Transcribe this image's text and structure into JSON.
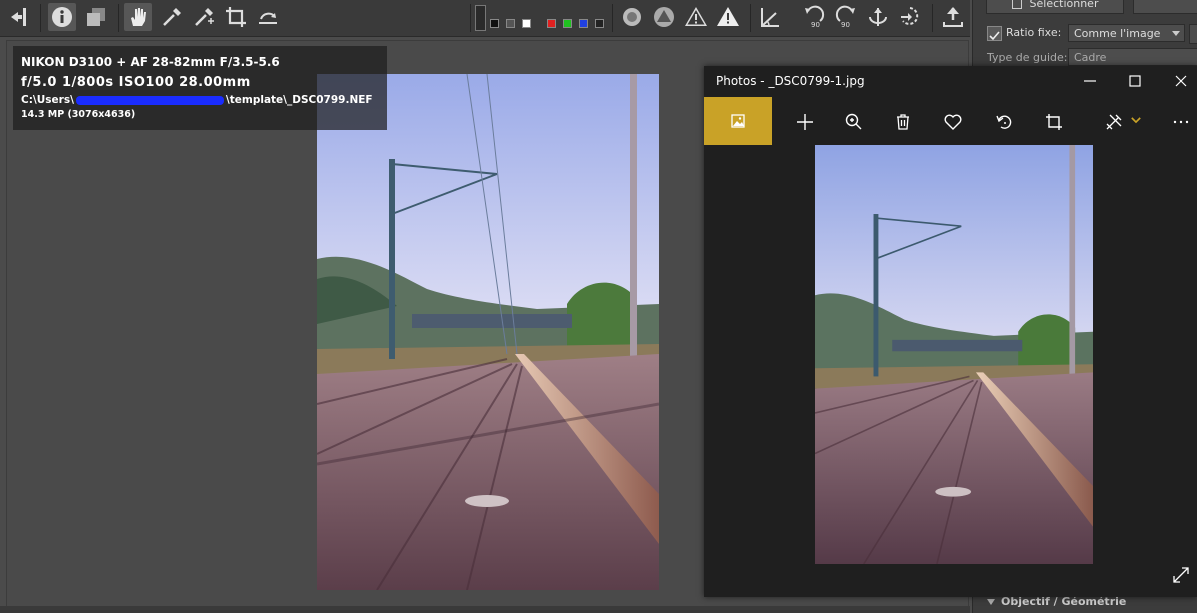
{
  "info": {
    "camera": "NIKON D3100 + AF 28-82mm F/3.5-5.6",
    "exposure": "f/5.0  1/800s  ISO100  28.00mm",
    "path_start": "C:\\Users\\",
    "path_end": "\\template\\_DSC0799.NEF",
    "resolution": "14.3 MP (3076x4636)"
  },
  "panel": {
    "select_button": "Sélectionner",
    "ratio_label": "Ratio fixe:",
    "ratio_value": "Comme l'image",
    "guide_label": "Type de guide:",
    "guide_value": "Cadre",
    "section_lens": "Objectif / Géométrie"
  },
  "photos_window": {
    "title": "Photos - _DSC0799-1.jpg",
    "icons": [
      "picture-icon",
      "plus-icon",
      "zoom-in-icon",
      "delete-icon",
      "heart-icon",
      "rotate-icon",
      "crop-icon",
      "edit-icon",
      "more-icon"
    ]
  },
  "colors": {
    "toolbar": "#3a3a3a",
    "photos_accent": "#c9a227",
    "sky_top": "#a9b6ee",
    "wood": "#7d5a63"
  }
}
